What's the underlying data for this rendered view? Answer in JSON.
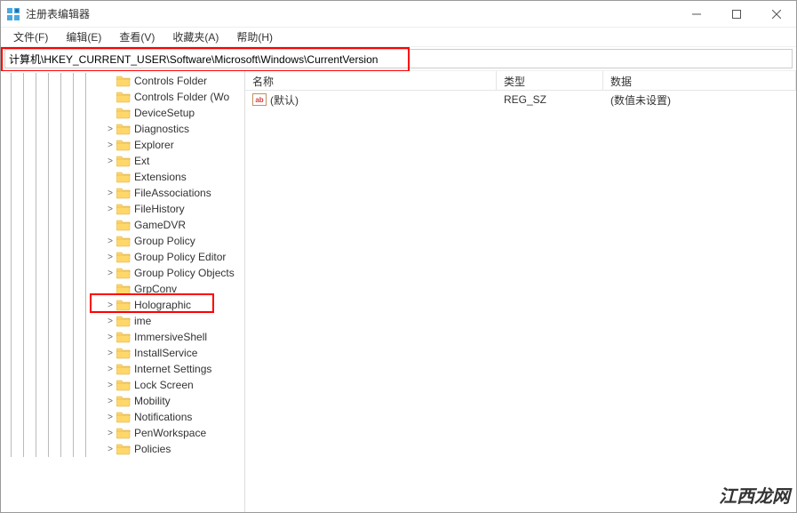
{
  "window": {
    "title": "注册表编辑器"
  },
  "menu": {
    "file": "文件(F)",
    "edit": "编辑(E)",
    "view": "查看(V)",
    "favorites": "收藏夹(A)",
    "help": "帮助(H)"
  },
  "address": "计算机\\HKEY_CURRENT_USER\\Software\\Microsoft\\Windows\\CurrentVersion",
  "tree": [
    {
      "label": "Controls Folder",
      "expand": "",
      "depth": 8
    },
    {
      "label": "Controls Folder (Wo",
      "expand": "",
      "depth": 8
    },
    {
      "label": "DeviceSetup",
      "expand": "",
      "depth": 8
    },
    {
      "label": "Diagnostics",
      "expand": ">",
      "depth": 8
    },
    {
      "label": "Explorer",
      "expand": ">",
      "depth": 8
    },
    {
      "label": "Ext",
      "expand": ">",
      "depth": 8
    },
    {
      "label": "Extensions",
      "expand": "",
      "depth": 8
    },
    {
      "label": "FileAssociations",
      "expand": ">",
      "depth": 8
    },
    {
      "label": "FileHistory",
      "expand": ">",
      "depth": 8
    },
    {
      "label": "GameDVR",
      "expand": "",
      "depth": 8
    },
    {
      "label": "Group Policy",
      "expand": ">",
      "depth": 8
    },
    {
      "label": "Group Policy Editor",
      "expand": ">",
      "depth": 8
    },
    {
      "label": "Group Policy Objects",
      "expand": ">",
      "depth": 8
    },
    {
      "label": "GrpConv",
      "expand": "",
      "depth": 8
    },
    {
      "label": "Holographic",
      "expand": ">",
      "depth": 8,
      "highlight": true
    },
    {
      "label": "ime",
      "expand": ">",
      "depth": 8
    },
    {
      "label": "ImmersiveShell",
      "expand": ">",
      "depth": 8
    },
    {
      "label": "InstallService",
      "expand": ">",
      "depth": 8
    },
    {
      "label": "Internet Settings",
      "expand": ">",
      "depth": 8
    },
    {
      "label": "Lock Screen",
      "expand": ">",
      "depth": 8
    },
    {
      "label": "Mobility",
      "expand": ">",
      "depth": 8
    },
    {
      "label": "Notifications",
      "expand": ">",
      "depth": 8
    },
    {
      "label": "PenWorkspace",
      "expand": ">",
      "depth": 8
    },
    {
      "label": "Policies",
      "expand": ">",
      "depth": 8
    }
  ],
  "list": {
    "headers": {
      "name": "名称",
      "type": "类型",
      "data": "数据"
    },
    "rows": [
      {
        "name": "(默认)",
        "type": "REG_SZ",
        "data": "(数值未设置)"
      }
    ]
  },
  "watermark": "江西龙网"
}
